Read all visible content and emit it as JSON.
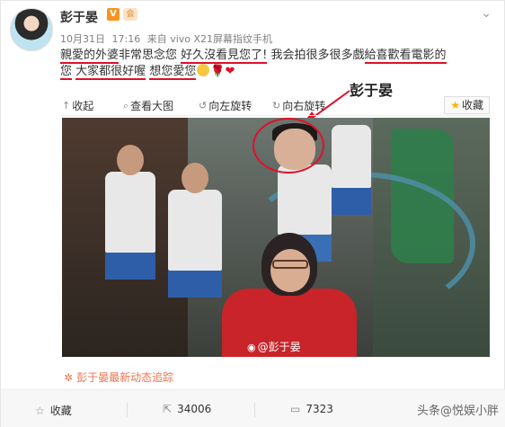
{
  "author": {
    "name": "彭于晏",
    "vip_badge": "V",
    "member_badge": "会"
  },
  "meta": {
    "date": "10月31日",
    "time": "17:16",
    "source": "来自 vivo X21屏幕指纹手机"
  },
  "content": {
    "line1_a": "親愛的外婆",
    "line1_b": "非常思念您",
    "line1_c": "好久沒看見您了!",
    "line1_d": "我会拍很多很多戲",
    "line1_e": "給喜歡看電影的",
    "line2_a": "您",
    "line2_b": "大家都很好喔",
    "line2_c": "想您愛您",
    "rose_icon": "🌹",
    "heart_icon": "❤"
  },
  "toolbar": {
    "collapse": "收起",
    "view_large": "查看大图",
    "rotate_left": "向左旋转",
    "rotate_right": "向右旋转",
    "favorite": "收藏"
  },
  "annotation": {
    "label": "彭于晏"
  },
  "photo": {
    "watermark": "@彭于晏"
  },
  "track": {
    "text": "彭于晏最新动态追踪"
  },
  "actions": {
    "favorite": "收藏",
    "repost": "34006",
    "comments": "7323",
    "brand": "头条@悦娱小胖"
  },
  "colors": {
    "link": "#eb7350",
    "underline": "#e0102a",
    "vip": "#f7931e"
  }
}
